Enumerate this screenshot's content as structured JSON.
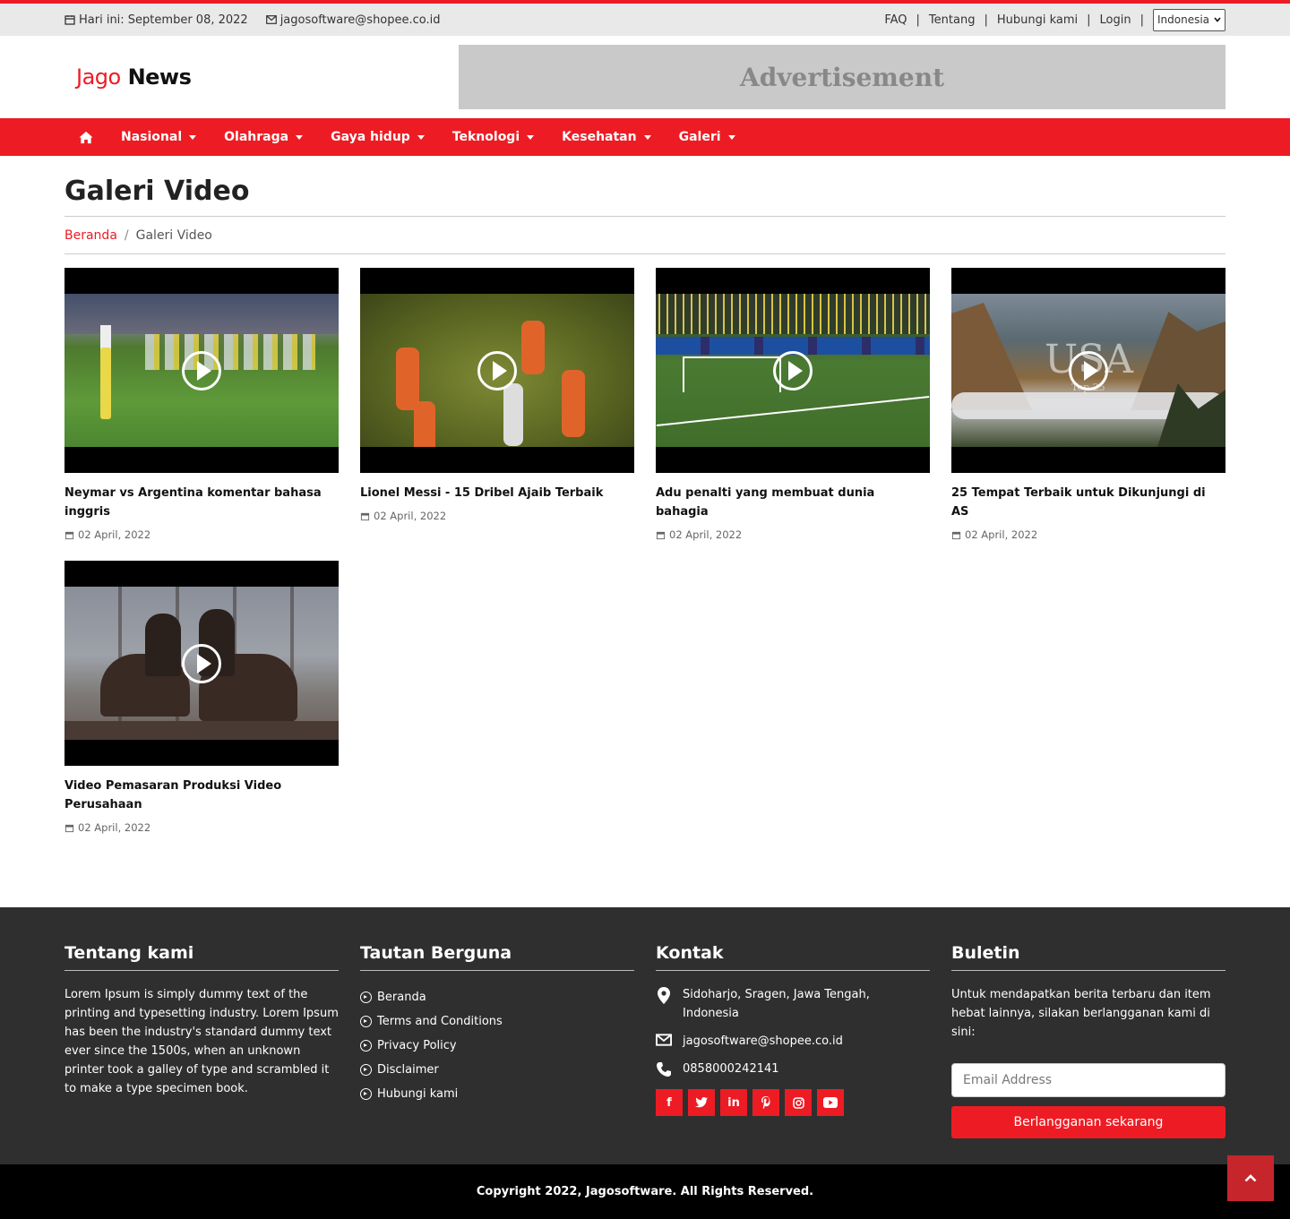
{
  "topbar": {
    "date_label": "Hari ini: September 08, 2022",
    "email": "jagosoftware@shopee.co.id",
    "links": [
      "FAQ",
      "Tentang",
      "Hubungi kami",
      "Login"
    ],
    "language": "Indonesia"
  },
  "header": {
    "logo_part1": "Jago",
    "logo_part2": "News",
    "ad_label": "Advertisement"
  },
  "nav": {
    "items": [
      "Nasional",
      "Olahraga",
      "Gaya hidup",
      "Teknologi",
      "Kesehatan",
      "Galeri"
    ]
  },
  "page": {
    "title": "Galeri Video",
    "breadcrumb_home": "Beranda",
    "breadcrumb_current": "Galeri Video"
  },
  "videos": [
    {
      "title": "Neymar vs Argentina komentar bahasa inggris",
      "date": "02 April, 2022"
    },
    {
      "title": "Lionel Messi - 15 Dribel Ajaib Terbaik",
      "date": "02 April, 2022"
    },
    {
      "title": "Adu penalti yang membuat dunia bahagia",
      "date": "02 April, 2022"
    },
    {
      "title": "25 Tempat Terbaik untuk Dikunjungi di AS",
      "date": "02 April, 2022",
      "overlay_text": "USA",
      "overlay_sub": "Top 25"
    },
    {
      "title": "Video Pemasaran Produksi Video Perusahaan",
      "date": "02 April, 2022"
    }
  ],
  "footer": {
    "about": {
      "heading": "Tentang kami",
      "text": "Lorem Ipsum is simply dummy text of the printing and typesetting industry. Lorem Ipsum has been the industry's standard dummy text ever since the 1500s, when an unknown printer took a galley of type and scrambled it to make a type specimen book."
    },
    "links": {
      "heading": "Tautan Berguna",
      "items": [
        "Beranda",
        "Terms and Conditions",
        "Privacy Policy",
        "Disclaimer",
        "Hubungi kami"
      ]
    },
    "contact": {
      "heading": "Kontak",
      "address": "Sidoharjo, Sragen, Jawa Tengah, Indonesia",
      "email": "jagosoftware@shopee.co.id",
      "phone": "0858000242141",
      "socials": [
        "facebook-icon",
        "twitter-icon",
        "linkedin-icon",
        "pinterest-icon",
        "instagram-icon",
        "youtube-icon"
      ]
    },
    "newsletter": {
      "heading": "Buletin",
      "text": "Untuk mendapatkan berita terbaru dan item hebat lainnya, silakan berlangganan kami di sini:",
      "placeholder": "Email Address",
      "button": "Berlangganan sekarang"
    },
    "copyright": "Copyright 2022, Jagosoftware. All Rights Reserved."
  },
  "colors": {
    "accent": "#ed1c24",
    "footer_bg": "#2f2f2f",
    "topbar_bg": "#e9e9e9"
  }
}
